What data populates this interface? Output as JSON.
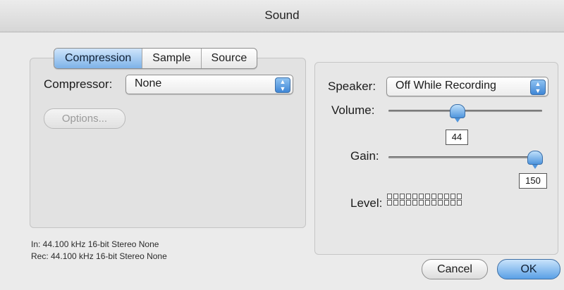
{
  "window": {
    "title": "Sound"
  },
  "tabs": [
    "Compression",
    "Sample",
    "Source"
  ],
  "compression": {
    "compressor_label": "Compressor:",
    "compressor_value": "None",
    "options_label": "Options..."
  },
  "speaker": {
    "label": "Speaker:",
    "value": "Off While Recording"
  },
  "volume": {
    "label": "Volume:",
    "value": "44",
    "level": 0.44
  },
  "gain": {
    "label": "Gain:",
    "value": "150",
    "level": 0.96
  },
  "level": {
    "label": "Level:"
  },
  "info": {
    "in": "In: 44.100 kHz 16-bit Stereo None",
    "rec": "Rec: 44.100 kHz 16-bit Stereo None"
  },
  "buttons": {
    "cancel": "Cancel",
    "ok": "OK"
  },
  "colors": {
    "accent": "#5aa0e6"
  }
}
